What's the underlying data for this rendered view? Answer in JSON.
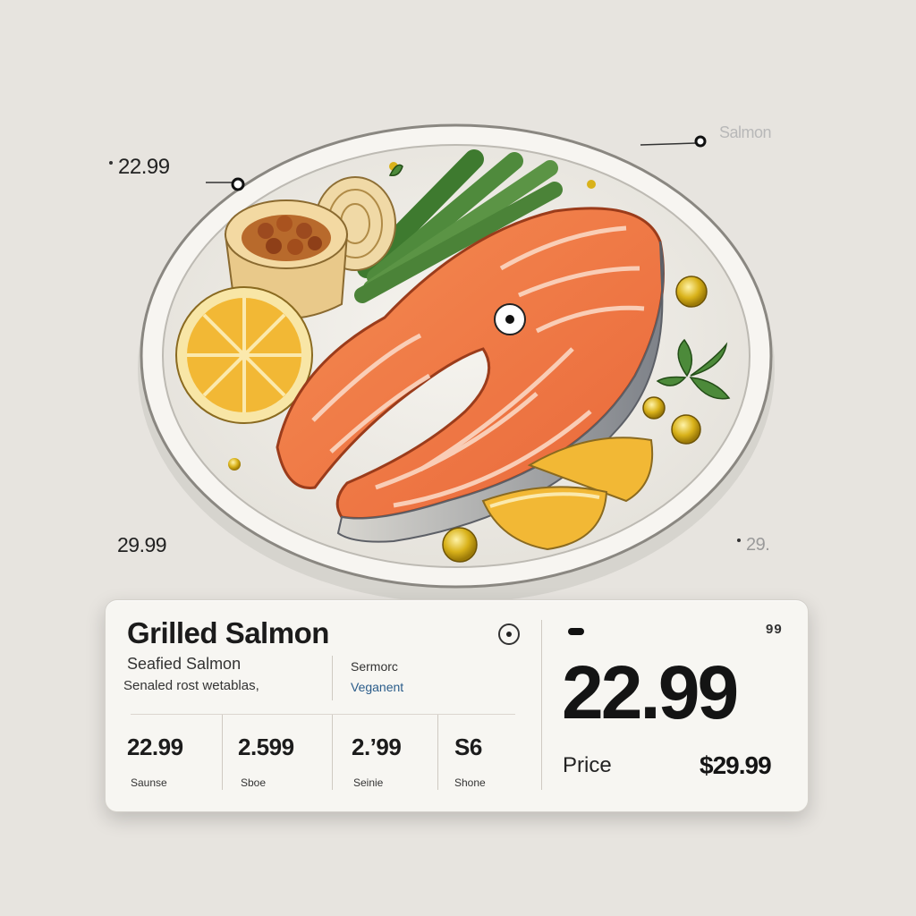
{
  "floating_labels": {
    "top_left_price": "22.99",
    "mid_left_price": "29.99",
    "right_price": "29.",
    "top_right_ghost": "Salmon"
  },
  "card": {
    "title": "Grilled Salmon",
    "subtitle_line1": "Seafied Salmon",
    "subtitle_line2": "Senaled rost wetablas,",
    "tag_line1": "Sermorc",
    "tag_line2": "Veganent",
    "cells": [
      {
        "price": "22.99",
        "label": "Saunse"
      },
      {
        "price": "2.599",
        "label": "Sboe"
      },
      {
        "price": "2.’99",
        "label": "Seinie"
      },
      {
        "price": "S6",
        "label": "Shone"
      }
    ],
    "big_price": "22.99",
    "corner_marks": "99",
    "price_label": "Price",
    "price_alt": "$29.99"
  },
  "colors": {
    "background": "#e7e4df",
    "plate": "#f1efe9",
    "salmon": "#f07a45",
    "lemon": "#f2b835",
    "asparagus": "#4f8a3c"
  },
  "icons": {
    "info": "info-circle-icon",
    "callout": "callout-dot-icon"
  }
}
